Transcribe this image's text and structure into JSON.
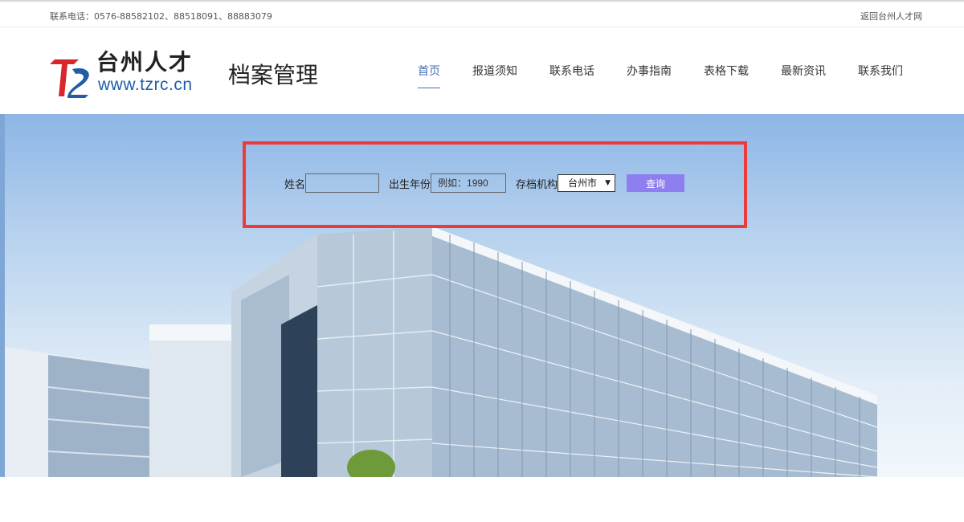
{
  "topbar": {
    "contact": "联系电话：0576-88582102、88518091、88883079",
    "back_link": "返回台州人才网"
  },
  "header": {
    "logo_brand": "台州人才",
    "logo_url": "www.tzrc.cn",
    "site_title": "档案管理",
    "nav": [
      {
        "label": "首页",
        "active": true
      },
      {
        "label": "报道须知"
      },
      {
        "label": "联系电话"
      },
      {
        "label": "办事指南"
      },
      {
        "label": "表格下载"
      },
      {
        "label": "最新资讯"
      },
      {
        "label": "联系我们"
      }
    ]
  },
  "search": {
    "name_label": "姓名",
    "name_value": "",
    "year_label": "出生年份",
    "year_placeholder": "例如：1990",
    "org_label": "存档机构",
    "org_selected": "台州市",
    "query_button": "查询"
  },
  "colors": {
    "highlight_border": "#ee3a3a",
    "query_button_bg": "#8e7ff0",
    "nav_active": "#4a6bb5",
    "logo_url": "#1f5da8",
    "logo_mark_red": "#d8262c"
  },
  "icons": {
    "logo_mark": "tz-logo-icon",
    "select_caret": "caret-down-icon"
  }
}
